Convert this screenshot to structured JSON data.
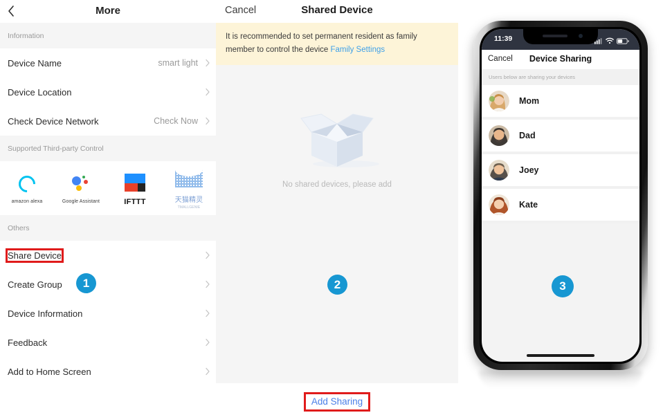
{
  "left_panel": {
    "nav": {
      "back_icon": "back-chevron-icon",
      "title": "More"
    },
    "sections": [
      {
        "header": "Information",
        "rows": [
          {
            "label": "Device Name",
            "value": "smart light"
          },
          {
            "label": "Device Location",
            "value": ""
          },
          {
            "label": "Check Device Network",
            "value": "Check Now"
          }
        ]
      },
      {
        "header": "Supported Third-party Control",
        "brands": [
          {
            "name": "amazon alexa",
            "icon": "amazon-alexa-icon"
          },
          {
            "name": "Google Assistant",
            "icon": "google-assistant-icon"
          },
          {
            "name": "IFTTT",
            "icon": "ifttt-icon"
          },
          {
            "name": "天猫精灵",
            "subname": "TMALLGENIE",
            "icon": "tmall-genie-icon"
          }
        ]
      },
      {
        "header": "Others",
        "rows": [
          {
            "label": "Share Device",
            "value": ""
          },
          {
            "label": "Create Group",
            "value": ""
          },
          {
            "label": "Device Information",
            "value": ""
          },
          {
            "label": "Feedback",
            "value": ""
          },
          {
            "label": "Add to Home Screen",
            "value": ""
          }
        ]
      }
    ]
  },
  "mid_panel": {
    "nav": {
      "cancel": "Cancel",
      "title": "Shared Device"
    },
    "notice": {
      "text": "It is recommended to set permanent resident as family member to control the device ",
      "link": "Family Settings"
    },
    "empty": {
      "illustration": "open-box-icon",
      "text": "No shared devices, please add"
    },
    "add_sharing": "Add Sharing"
  },
  "phone_panel": {
    "status_bar": {
      "time": "11:39",
      "signal_icon": "cellular-signal-icon",
      "wifi_icon": "wifi-icon",
      "battery_icon": "battery-icon"
    },
    "nav": {
      "cancel": "Cancel",
      "title": "Device Sharing"
    },
    "hint": "Users below are sharing your devices",
    "contacts": [
      {
        "name": "Mom",
        "avatar": "avatar-mom"
      },
      {
        "name": "Dad",
        "avatar": "avatar-dad"
      },
      {
        "name": "Joey",
        "avatar": "avatar-joey"
      },
      {
        "name": "Kate",
        "avatar": "avatar-kate"
      }
    ]
  },
  "annotations": {
    "step1": "1",
    "step2": "2",
    "step3": "3",
    "badge_color": "#1797d2",
    "highlight_color": "#e01b1b"
  }
}
